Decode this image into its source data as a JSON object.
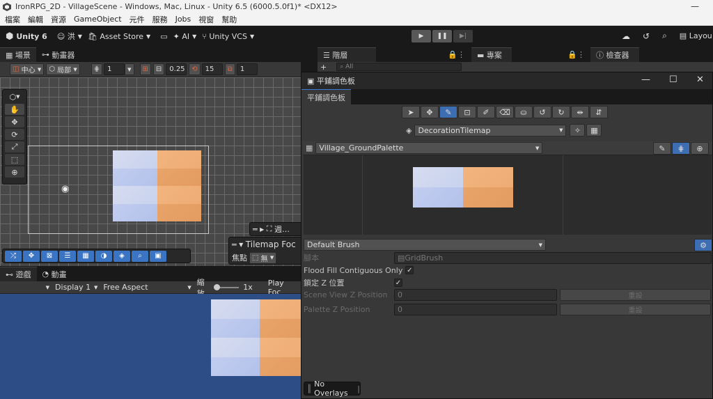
{
  "window": {
    "title": "IronRPG_2D - VillageScene - Windows, Mac, Linux - Unity 6.5 (6000.5.0f1)* <DX12>",
    "minimize": "—"
  },
  "menu": [
    "檔案",
    "編輯",
    "資源",
    "GameObject",
    "元件",
    "服務",
    "Jobs",
    "視窗",
    "幫助"
  ],
  "toolbar": {
    "brand": "Unity 6",
    "account": "洪",
    "asset_store": "Asset Store",
    "ai": "AI",
    "vcs": "Unity VCS",
    "layout": "Layou"
  },
  "scene": {
    "tabs": [
      "場景",
      "動畫器"
    ],
    "pivot": "中心",
    "space": "局部",
    "grid_value": "1",
    "snap_value": "0.25",
    "angle_value": "15",
    "scale_value": "1",
    "overlay_label": "週…",
    "tilemap_focus": "Tilemap Foc",
    "focus_label": "焦點",
    "focus_value": "無"
  },
  "game": {
    "tabs": [
      "遊戲",
      "動畫"
    ],
    "display": "Display 1",
    "aspect": "Free Aspect",
    "scale_label": "縮放",
    "scale_value": "1x",
    "play_focus": "Play Foc"
  },
  "right_tabs": [
    "階層",
    "專案",
    "檢查器"
  ],
  "right_search": "All",
  "palette": {
    "window_title": "平鋪調色板",
    "tab": "平鋪調色板",
    "target": "DecorationTilemap",
    "palette_name": "Village_GroundPalette",
    "brush": "Default Brush",
    "script_label": "腳本",
    "script_value": "GridBrush",
    "flood_fill": "Flood Fill Contiguous Only",
    "lock_z": "鎖定 Z 位置",
    "scene_z": "Scene View Z Position",
    "scene_z_value": "0",
    "palette_z": "Palette Z Position",
    "palette_z_value": "0",
    "reset": "重設",
    "no_overlays": "No Overlays"
  },
  "colors": {
    "accent": "#3d7ad6",
    "tile_blue": "#c8d2ee",
    "tile_orange": "#eeac74",
    "game_bg": "#2d4d86"
  }
}
